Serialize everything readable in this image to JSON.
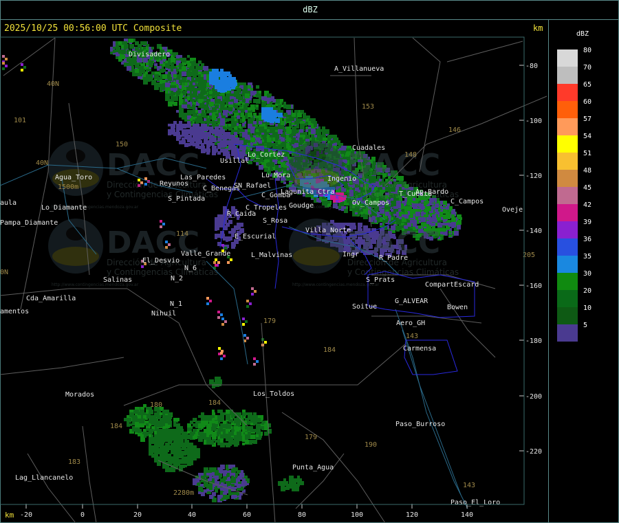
{
  "title": "dBZ",
  "header": "2025/10/25 00:56:00 UTC Composite",
  "axis_unit": "km",
  "x_ticks": [
    "-20",
    "0",
    "20",
    "40",
    "60",
    "80",
    "100",
    "120",
    "140"
  ],
  "y_ticks": [
    "-80",
    "-100",
    "-120",
    "-140",
    "-160",
    "-180",
    "-200",
    "-220"
  ],
  "legend": {
    "unit": "dBZ",
    "levels": [
      {
        "label": "80",
        "color": "#d8d8d8"
      },
      {
        "label": "70",
        "color": "#bebebe"
      },
      {
        "label": "65",
        "color": "#ff3a2a"
      },
      {
        "label": "60",
        "color": "#ff5f0a"
      },
      {
        "label": "57",
        "color": "#ff9a5a"
      },
      {
        "label": "54",
        "color": "#ffff00"
      },
      {
        "label": "51",
        "color": "#f8c030"
      },
      {
        "label": "48",
        "color": "#d08a40"
      },
      {
        "label": "45",
        "color": "#c06a90"
      },
      {
        "label": "42",
        "color": "#d0188a"
      },
      {
        "label": "39",
        "color": "#8a20d0"
      },
      {
        "label": "36",
        "color": "#2850e0"
      },
      {
        "label": "35",
        "color": "#1a88e0"
      },
      {
        "label": "30",
        "color": "#108a10"
      },
      {
        "label": "20",
        "color": "#0a6a18"
      },
      {
        "label": "10",
        "color": "#0e5a14"
      },
      {
        "label": "5",
        "color": "#4a3a90"
      }
    ]
  },
  "places": [
    "Divisadero",
    "A_Villanueva",
    "40N",
    "101",
    "153",
    "146",
    "150",
    "Usillal",
    "Lo_Cortez",
    "Cuadales",
    "148",
    "40N",
    "Agua_Toro",
    "1500m",
    "SN_Rafael",
    "Lu_Mora",
    "Reyunos",
    "C_Benegas",
    "Las_Paredes",
    "Ingenio",
    "T_Cuesta",
    "Ap_Bardo",
    "C_Campos",
    "Lagunita_Ctra",
    "Pampa_Diamante",
    "S_Pintada",
    "Lo_Diamante",
    "aula",
    "C_Gomba",
    "C_Tropeles",
    "Goudge",
    "Ov_Campos",
    "Oveje",
    "R_Caida",
    "S_Rosa",
    "Villa_Norte",
    "E_Escurial",
    "114",
    "Valle_Grande",
    "L_Malvinas",
    "Ingr",
    "R_Padre",
    "El_Desvio",
    "S_Prats",
    "205",
    "N_6",
    "N_2",
    "Salinas",
    "CompartEscard",
    "0N",
    "Cda_Amarilla",
    "N_1",
    "G_ALVEAR",
    "Bowen",
    "amentos",
    "Nihuil",
    "Soitue",
    "179",
    "Aero_GH",
    "143",
    "184",
    "Carmensa",
    "Morados",
    "Los_Toldos",
    "180",
    "184",
    "Paso_Burroso",
    "184",
    "179",
    "190",
    "183",
    "Lag_Llancanelo",
    "Punta_Agua",
    "2280m",
    "143",
    "Paso_El_Loro"
  ],
  "watermark": {
    "brand": "DACC",
    "line1": "Dirección de Agricultura",
    "line2": "y Contingencias Climáticas",
    "url": "http://www.contingencias.mendoza.gov.ar"
  }
}
